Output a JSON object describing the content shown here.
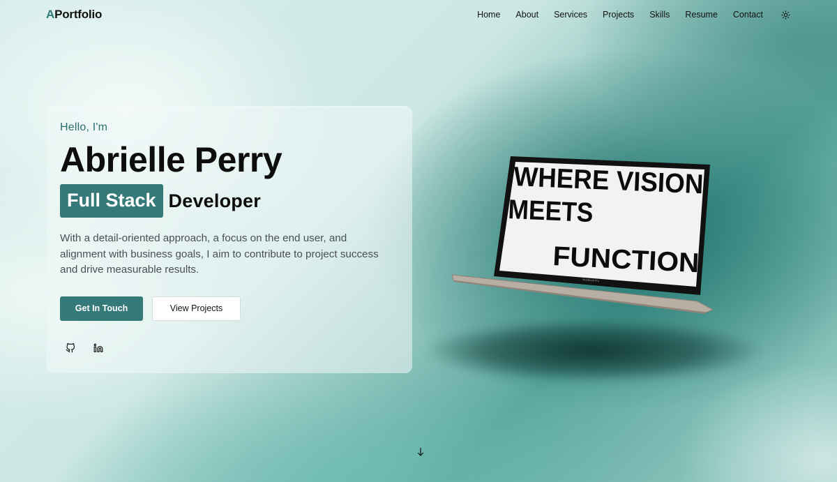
{
  "nav": {
    "logo_accent": "A",
    "logo_rest": "Portfolio",
    "links": [
      "Home",
      "About",
      "Services",
      "Projects",
      "Skills",
      "Resume",
      "Contact"
    ],
    "theme_icon": "sun-icon"
  },
  "hero": {
    "greeting": "Hello, I'm",
    "name": "Abrielle Perry",
    "role_highlight": "Full Stack",
    "role_rest": "Developer",
    "bio": "With a detail-oriented approach, a focus on the end user, and alignment with business goals, I aim to contribute to project success and drive measurable results.",
    "primary_button": "Get In Touch",
    "secondary_button": "View Projects",
    "socials": [
      "github-icon",
      "linkedin-icon"
    ]
  },
  "laptop": {
    "screen_lines": [
      "WHERE VISION",
      "MEETS",
      "FUNCTION"
    ],
    "brand": "MacBook Pro"
  },
  "scroll_icon": "arrow-down-icon",
  "colors": {
    "accent": "#357a78",
    "greeting": "#2b6f6f",
    "text": "#0d0d0d",
    "body_text": "#4a4f52"
  }
}
